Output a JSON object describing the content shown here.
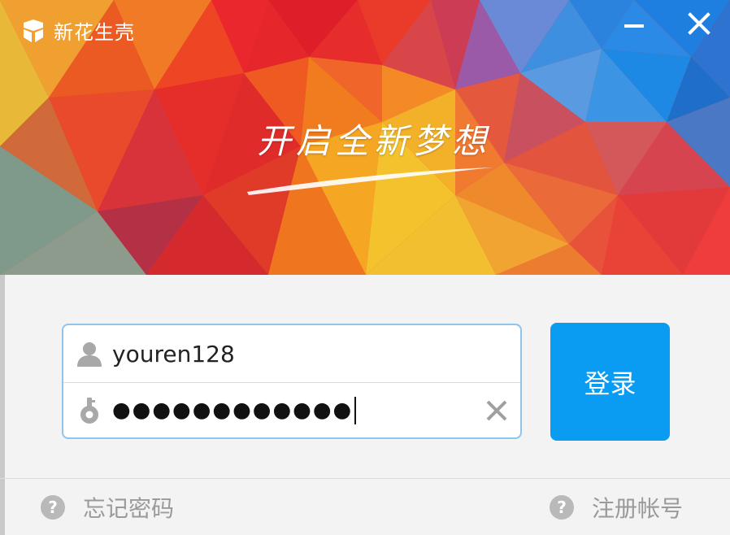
{
  "app": {
    "title": "新花生壳",
    "slogan": "开启全新梦想"
  },
  "window_controls": {
    "minimize_icon": "minimize-icon",
    "close_icon": "close-icon"
  },
  "login_form": {
    "username": "youren128",
    "password_mask": "●●●●●●●●●●●●",
    "login_label": "登录"
  },
  "footer": {
    "forgot_password": "忘记密码",
    "register": "注册帐号"
  },
  "colors": {
    "accent": "#0a9bf2",
    "input_border": "#8fc4ec",
    "link_gray": "#9a9a9a"
  }
}
